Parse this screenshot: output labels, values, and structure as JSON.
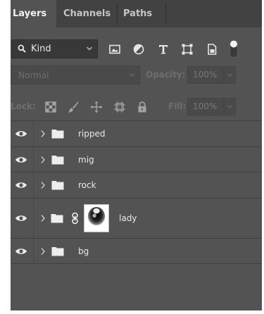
{
  "tabs": [
    {
      "label": "Layers",
      "active": true
    },
    {
      "label": "Channels",
      "active": false
    },
    {
      "label": "Paths",
      "active": false
    }
  ],
  "filter": {
    "kind_label": "Kind",
    "icons": [
      "image-filter-icon",
      "adjustment-filter-icon",
      "type-filter-icon",
      "shape-filter-icon",
      "smart-object-filter-icon",
      "filter-toggle-icon"
    ]
  },
  "blend": {
    "mode": "Normal",
    "opacity_label": "Opacity:",
    "opacity_value": "100%"
  },
  "lock": {
    "label": "Lock:",
    "fill_label": "Fill:",
    "fill_value": "100%"
  },
  "layers": [
    {
      "name": "ripped",
      "type": "group",
      "visible": true
    },
    {
      "name": "mig",
      "type": "group",
      "visible": true
    },
    {
      "name": "rock",
      "type": "group",
      "visible": true
    },
    {
      "name": "lady",
      "type": "group",
      "visible": true,
      "linked_mask": true
    },
    {
      "name": "bg",
      "type": "group",
      "visible": true
    }
  ],
  "colors": {
    "panel_bg": "#535353",
    "tabbar_bg": "#424242",
    "text": "#e8e8e8",
    "disabled_text": "#6e6e6e"
  }
}
